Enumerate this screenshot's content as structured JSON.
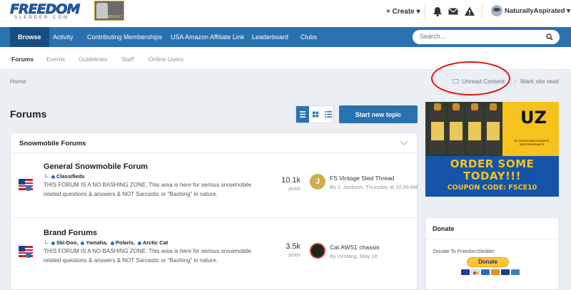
{
  "header": {
    "logo_text": "FREEDOM",
    "logo_sub": "SLEDDER.COM",
    "badge_year": "1989-2017",
    "create_label": "+ Create",
    "username": "NaturallyAspirated"
  },
  "nav": {
    "items": [
      "Browse",
      "Activity",
      "Contributing Memberships",
      "USA Amazon Affiliate Link",
      "Leaderboard",
      "Clubs"
    ],
    "search_placeholder": "Search..."
  },
  "subnav": {
    "items": [
      "Forums",
      "Events",
      "Guidelines",
      "Staff",
      "Online Users"
    ]
  },
  "breadcrumb": {
    "home": "Home",
    "unread": "Unread Content",
    "mark_read": "Mark site read"
  },
  "main": {
    "title": "Forums",
    "start_topic": "Start new topic"
  },
  "panel": {
    "title": "Snowmobile Forums",
    "forums": [
      {
        "title": "General Snowmobile Forum",
        "subforums": [
          "Classifieds"
        ],
        "description": "THIS FORUM IS A NO BASHING ZONE. This area is here for serious snowmobile related questions & answers & NOT Sarcastic or \"Bashing\" in nature.",
        "posts": "10.1k",
        "posts_label": "posts",
        "last_title": "FS Vintage Sled Thread",
        "last_by": "By J. Jackson, Thursday at 10:39 AM",
        "avatar_letter": "J"
      },
      {
        "title": "Brand Forums",
        "subforums": [
          "Ski-Doo,",
          "Yamaha,",
          "Polaris,",
          "Arctic Cat"
        ],
        "description": "THIS FORUM IS A NO BASHING ZONE. This area is here for serious snowmobile related questions & answers & NOT Sarcastic or \"Bashing\" in nature.",
        "posts": "3.5k",
        "posts_label": "posts",
        "last_title": "Cat AWS1 chassis",
        "last_by": "By mrstang, May 18"
      }
    ]
  },
  "ad": {
    "mark": "UZ",
    "by": "BY FREEDOMSLEDDER'S SEATOFMYPANTS",
    "order_line1": "ORDER SOME",
    "order_line2": "TODAY!!!",
    "coupon": "COUPON CODE: FSCE10"
  },
  "donate": {
    "title": "Donate",
    "text": "Donate To FreedomSledder",
    "button": "Donate"
  },
  "colors": {
    "brand_blue": "#2a71b0",
    "nav_active": "#184d82",
    "annotation_red": "#e01010"
  }
}
